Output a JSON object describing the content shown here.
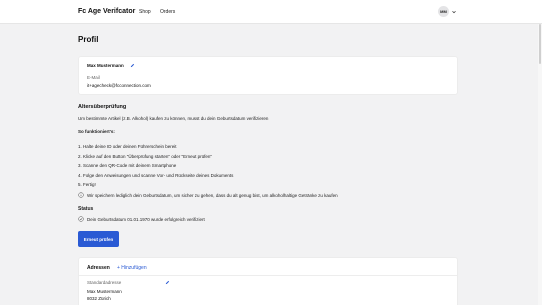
{
  "header": {
    "app_title": "Fc Age Verifcator",
    "nav": [
      "Shop",
      "Orders"
    ],
    "user_initials": "MM"
  },
  "page": {
    "title": "Profil"
  },
  "profile": {
    "name": "Max Mustermann",
    "email_label": "E-Mail",
    "email": "it+agecheck@fcconnection.com"
  },
  "age_verification": {
    "title": "Altersüberprüfung",
    "intro": "Um bestimmte Artikel (z.B. Alkohol) kaufen zu können, musst du dein Geburtsdatum verifizieren",
    "how_title": "So funktioniert's:",
    "steps": [
      "1. Halte deine ID oder deinen Führerschein bereit",
      "2. Klicke auf den Button \"Überprüfung starten\" oder \"Erneut prüfen\"",
      "3. Scanne den QR-Code mit deinem Smartphone",
      "4. Folge den Anweisungen und scanne Vor- und Rückseite deines Dokuments",
      "5. Fertig!"
    ],
    "info_note": "Wir speichern lediglich dein Geburtsdatum, um sicher zu gehen, dass du alt genug bist, um alkoholhaltige Getränke zu kaufen",
    "status_title": "Status",
    "status_text": "Dein Geburtsdatum 01.01.1970 wurde erfolgreich verifiziert",
    "retry_button": "Erneut prüfen"
  },
  "addresses": {
    "title": "Adressen",
    "add_label": "+ Hinzufügen",
    "default_label": "Standardadresse",
    "lines": [
      "Max Mustermann",
      "8032 Zürich"
    ]
  },
  "colors": {
    "accent": "#2a5ad4",
    "background": "#f2f2f3"
  }
}
